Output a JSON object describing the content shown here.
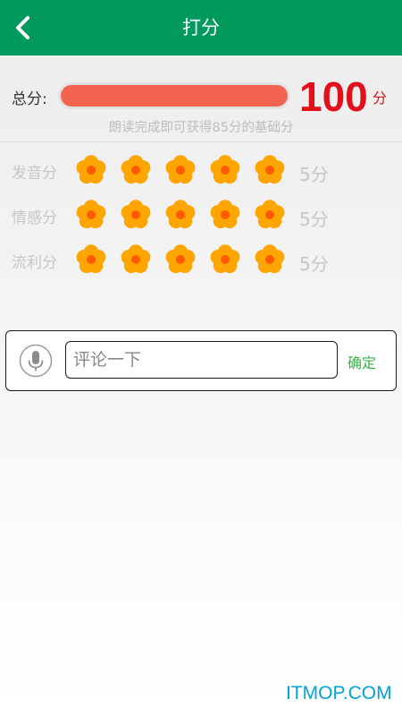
{
  "header": {
    "title": "打分",
    "background": "#009a5e"
  },
  "total": {
    "label": "总分:",
    "score": "100",
    "unit": "分",
    "fill_fraction": 1.0,
    "bar_color": "#f26350",
    "score_color": "#e2101a",
    "hint": "朗读完成即可获得85分的基础分"
  },
  "ratings": [
    {
      "label": "发音分",
      "stars": 5,
      "max": 5,
      "value": "5分"
    },
    {
      "label": "情感分",
      "stars": 5,
      "max": 5,
      "value": "5分"
    },
    {
      "label": "流利分",
      "stars": 5,
      "max": 5,
      "value": "5分"
    }
  ],
  "comment": {
    "placeholder": "评论一下",
    "value": "",
    "confirm_label": "确定",
    "mic_icon": "microphone-icon"
  },
  "flower_icon": "flower-icon",
  "watermark": "ITMOP.COM"
}
